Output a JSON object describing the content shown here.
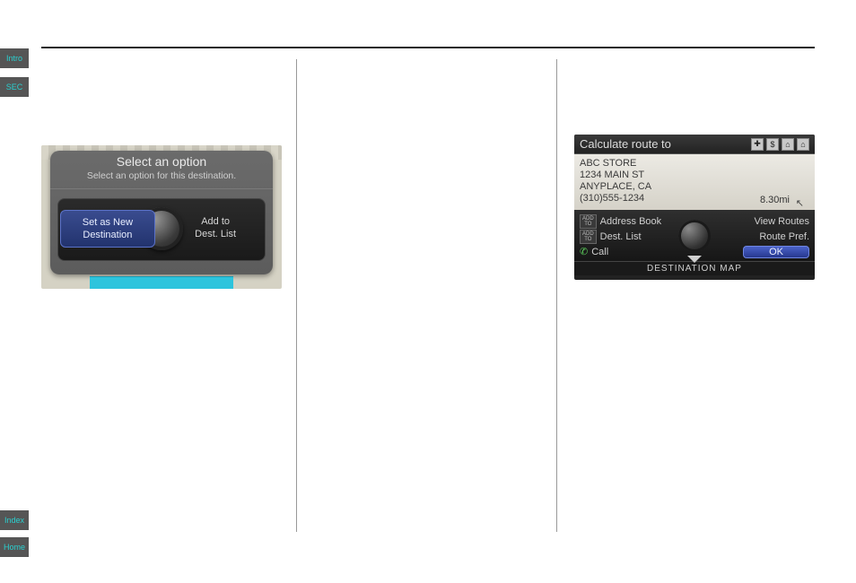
{
  "sideTabs": {
    "intro": "Intro",
    "sec": "SEC",
    "index": "Index",
    "home": "Home"
  },
  "shot1": {
    "title": "Select an option",
    "subtitle": "Select an option for this destination.",
    "optLeft": "Set as New\nDestination",
    "optRight": "Add to\nDest. List"
  },
  "shot2": {
    "header": "Calculate route to",
    "icons": [
      "✚",
      "$",
      "⌂",
      "⌂"
    ],
    "name": "ABC STORE",
    "addr1": "1234 MAIN ST",
    "addr2": "ANYPLACE, CA",
    "phone": "(310)555-1234",
    "distance": "8.30mi",
    "menu": {
      "addTo": "ADD TO",
      "r1l": "Address Book",
      "r1r": "View Routes",
      "r2l": "Dest. List",
      "r2r": "Route Pref.",
      "r3l": "Call",
      "r3r": "OK"
    },
    "footer": "DESTINATION MAP"
  }
}
